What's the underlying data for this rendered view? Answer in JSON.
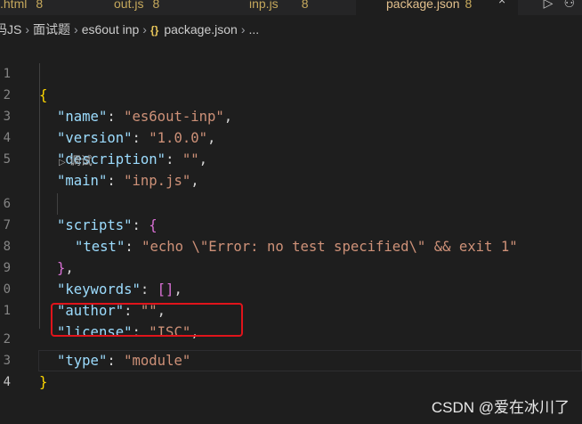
{
  "tabs": [
    {
      "name": ".html",
      "badge": "8"
    },
    {
      "name": "out.js",
      "badge": "8"
    },
    {
      "name": "inp.js",
      "badge": "8"
    },
    {
      "name": "package.json",
      "badge": "8",
      "active": true
    }
  ],
  "tab_close": "×",
  "tab_actions": [
    "▷",
    "⚇"
  ],
  "breadcrumb": [
    "码JS",
    "面试题",
    "es6out inp",
    "package.json",
    "..."
  ],
  "breadcrumb_json_icon": "{}",
  "codelens": "调试",
  "line_numbers": [
    "1",
    "2",
    "3",
    "4",
    "5",
    "6",
    "7",
    "8",
    "9",
    "0",
    "1",
    "2",
    "3",
    "4"
  ],
  "code": {
    "open_brace": "{",
    "name_key": "\"name\"",
    "name_val": "\"es6out-inp\"",
    "version_key": "\"version\"",
    "version_val": "\"1.0.0\"",
    "description_key": "\"description\"",
    "description_val": "\"\"",
    "main_key": "\"main\"",
    "main_val": "\"inp.js\"",
    "scripts_key": "\"scripts\"",
    "scripts_open": "{",
    "test_key": "\"test\"",
    "test_val": "\"echo \\\"Error: no test specified\\\" && exit 1\"",
    "scripts_close": "}",
    "keywords_key": "\"keywords\"",
    "keywords_val": "[]",
    "author_key": "\"author\"",
    "author_val": "\"\"",
    "license_key": "\"license\"",
    "license_val": "\"ISC\"",
    "type_key": "\"type\"",
    "type_val": "\"module\"",
    "close_brace": "}"
  },
  "watermark": "CSDN @爱在冰川了",
  "colors": {
    "background": "#1e1e1e",
    "key": "#9cdcfe",
    "string": "#ce9178",
    "bracket_level1": "#ffd700",
    "bracket_level2": "#da70d6",
    "highlight_box": "#e0141b"
  }
}
